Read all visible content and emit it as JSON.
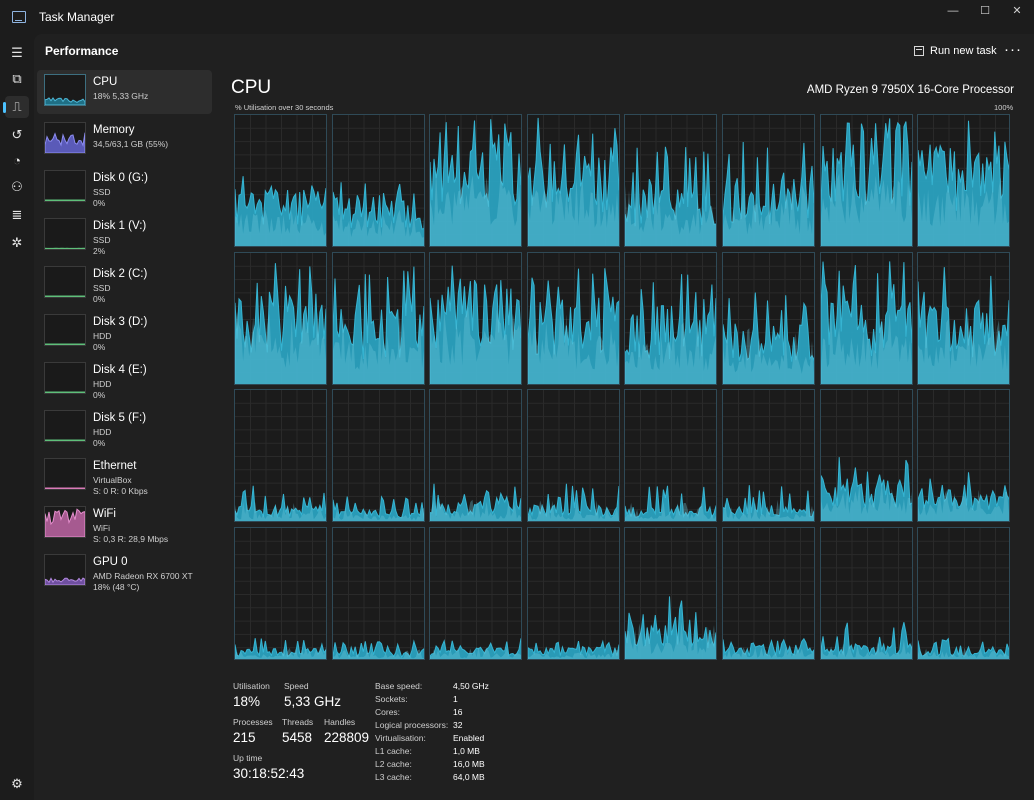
{
  "window": {
    "title": "Task Manager",
    "minimize": "—",
    "maximize": "☐",
    "close": "✕"
  },
  "rail": [
    {
      "name": "hamburger-menu-icon",
      "glyph": "☰"
    },
    {
      "name": "processes-icon",
      "glyph": "⧉"
    },
    {
      "name": "performance-icon",
      "glyph": "⎍"
    },
    {
      "name": "app-history-icon",
      "glyph": "↺"
    },
    {
      "name": "startup-apps-icon",
      "glyph": "◔"
    },
    {
      "name": "users-icon",
      "glyph": "⚇"
    },
    {
      "name": "details-icon",
      "glyph": "≣"
    },
    {
      "name": "services-icon",
      "glyph": "✲"
    },
    {
      "name": "settings-icon",
      "glyph": "⚙"
    }
  ],
  "header": {
    "title": "Performance",
    "run_task": "Run new task",
    "more": "···"
  },
  "sidebar": [
    {
      "name": "CPU",
      "line1": "18%  5,33 GHz",
      "line2": "",
      "color": "#4cb8d8",
      "fill": "#1f6f85",
      "level": 0.18,
      "selected": true
    },
    {
      "name": "Memory",
      "line1": "34,5/63,1 GB (55%)",
      "line2": "",
      "color": "#8c8cf0",
      "fill": "#5a5ab8",
      "level": 0.55,
      "selected": false
    },
    {
      "name": "Disk 0 (G:)",
      "line1": "SSD",
      "line2": "0%",
      "color": "#5fbf7a",
      "fill": "#1e4a2a",
      "level": 0.0,
      "selected": false
    },
    {
      "name": "Disk 1 (V:)",
      "line1": "SSD",
      "line2": "2%",
      "color": "#5fbf7a",
      "fill": "#2f6b46",
      "level": 0.02,
      "selected": false
    },
    {
      "name": "Disk 2 (C:)",
      "line1": "SSD",
      "line2": "0%",
      "color": "#5fbf7a",
      "fill": "#1e4a2a",
      "level": 0.0,
      "selected": false
    },
    {
      "name": "Disk 3 (D:)",
      "line1": "HDD",
      "line2": "0%",
      "color": "#5fbf7a",
      "fill": "#1e4a2a",
      "level": 0.0,
      "selected": false
    },
    {
      "name": "Disk 4 (E:)",
      "line1": "HDD",
      "line2": "0%",
      "color": "#5fbf7a",
      "fill": "#1e4a2a",
      "level": 0.0,
      "selected": false
    },
    {
      "name": "Disk 5 (F:)",
      "line1": "HDD",
      "line2": "0%",
      "color": "#5fbf7a",
      "fill": "#1e4a2a",
      "level": 0.0,
      "selected": false
    },
    {
      "name": "Ethernet",
      "line1": "VirtualBox",
      "line2": "S: 0 R: 0 Kbps",
      "color": "#d97bb8",
      "fill": "#5c2f4d",
      "level": 0.0,
      "selected": false
    },
    {
      "name": "WiFi",
      "line1": "WiFi",
      "line2": "S: 0,3 R: 28,9 Mbps",
      "color": "#e58fcd",
      "fill": "#a65a90",
      "level": 0.7,
      "selected": false
    },
    {
      "name": "GPU 0",
      "line1": "AMD Radeon RX 6700 XT",
      "line2": "18% (48 °C)",
      "color": "#b48ae0",
      "fill": "#6f4fa0",
      "level": 0.18,
      "selected": false
    }
  ],
  "detail": {
    "title": "CPU",
    "model": "AMD Ryzen 9 7950X 16-Core Processor",
    "axis_left": "% Utilisation over 30 seconds",
    "axis_right": "100%"
  },
  "colors": {
    "line": "#36b4d2",
    "fill": "#2aa1bf",
    "fill_light": "#6fc9de",
    "grid": "#2a2a2a",
    "accent": "#4cc2ff"
  },
  "cores": [
    {
      "level": 0.35,
      "peak": 0.55
    },
    {
      "level": 0.3,
      "peak": 0.5
    },
    {
      "level": 0.65,
      "peak": 0.98
    },
    {
      "level": 0.6,
      "peak": 0.98
    },
    {
      "level": 0.35,
      "peak": 0.8
    },
    {
      "level": 0.4,
      "peak": 0.8
    },
    {
      "level": 0.7,
      "peak": 1.0
    },
    {
      "level": 0.6,
      "peak": 1.0
    },
    {
      "level": 0.55,
      "peak": 0.95
    },
    {
      "level": 0.45,
      "peak": 0.9
    },
    {
      "level": 0.6,
      "peak": 1.0
    },
    {
      "level": 0.5,
      "peak": 0.92
    },
    {
      "level": 0.45,
      "peak": 0.85
    },
    {
      "level": 0.35,
      "peak": 0.75
    },
    {
      "level": 0.5,
      "peak": 0.95
    },
    {
      "level": 0.45,
      "peak": 0.9
    },
    {
      "level": 0.1,
      "peak": 0.28
    },
    {
      "level": 0.08,
      "peak": 0.2
    },
    {
      "level": 0.12,
      "peak": 0.3
    },
    {
      "level": 0.1,
      "peak": 0.3
    },
    {
      "level": 0.1,
      "peak": 0.28
    },
    {
      "level": 0.1,
      "peak": 0.3
    },
    {
      "level": 0.25,
      "peak": 0.52
    },
    {
      "level": 0.2,
      "peak": 0.42
    },
    {
      "level": 0.07,
      "peak": 0.18
    },
    {
      "level": 0.06,
      "peak": 0.15
    },
    {
      "level": 0.08,
      "peak": 0.18
    },
    {
      "level": 0.08,
      "peak": 0.15
    },
    {
      "level": 0.2,
      "peak": 0.5
    },
    {
      "level": 0.08,
      "peak": 0.18
    },
    {
      "level": 0.1,
      "peak": 0.3
    },
    {
      "level": 0.08,
      "peak": 0.17
    }
  ],
  "stats": {
    "utilisation_label": "Utilisation",
    "utilisation": "18%",
    "speed_label": "Speed",
    "speed": "5,33 GHz",
    "processes_label": "Processes",
    "processes": "215",
    "threads_label": "Threads",
    "threads": "5458",
    "handles_label": "Handles",
    "handles": "228809",
    "uptime_label": "Up time",
    "uptime": "30:18:52:43"
  },
  "specs": [
    {
      "label": "Base speed:",
      "value": "4,50 GHz"
    },
    {
      "label": "Sockets:",
      "value": "1"
    },
    {
      "label": "Cores:",
      "value": "16"
    },
    {
      "label": "Logical processors:",
      "value": "32"
    },
    {
      "label": "Virtualisation:",
      "value": "Enabled"
    },
    {
      "label": "L1 cache:",
      "value": "1,0 MB"
    },
    {
      "label": "L2 cache:",
      "value": "16,0 MB"
    },
    {
      "label": "L3 cache:",
      "value": "64,0 MB"
    }
  ]
}
